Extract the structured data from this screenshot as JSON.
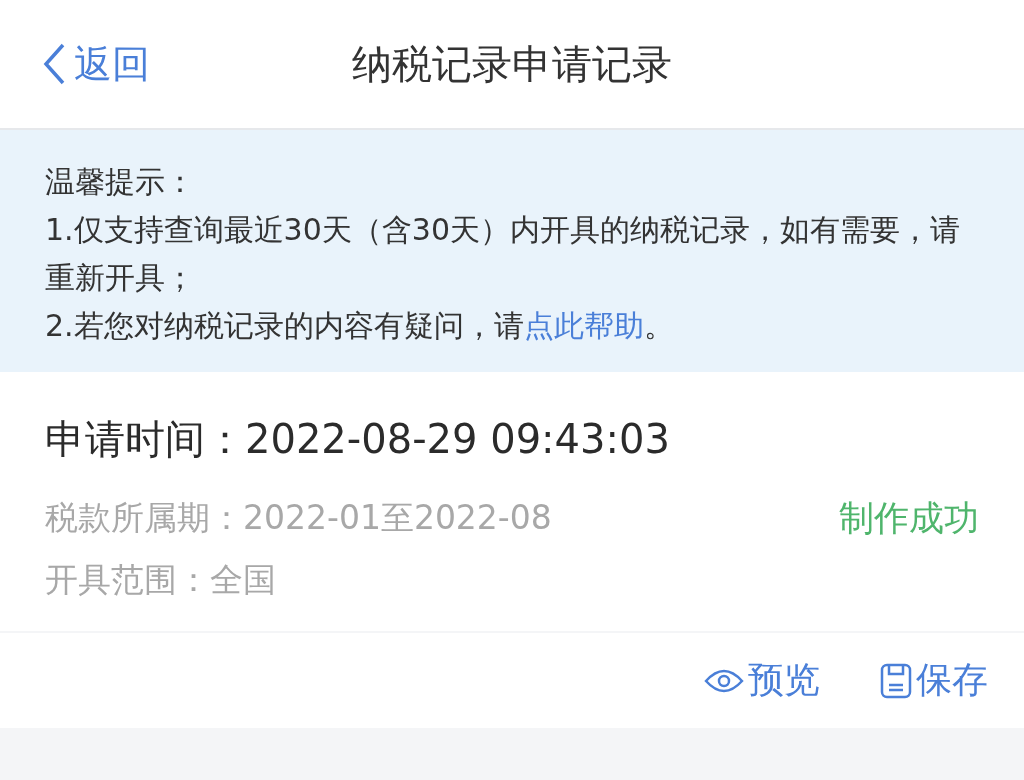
{
  "nav": {
    "back": "返回",
    "title": "纳税记录申请记录"
  },
  "notice": {
    "title": "温馨提示：",
    "items": [
      {
        "text": "1.仅支持查询最近30天（含30天）内开具的纳税记录，如有需要，请重新开具；"
      },
      {
        "text": "2.若您对纳税记录的内容有疑问，请",
        "link": "点此帮助",
        "suffix": "。"
      }
    ]
  },
  "record": {
    "time_label": "申请时间：",
    "time": "2022-08-29 09:43:03",
    "period_label": "税款所属期：",
    "period": "2022-01至2022-08",
    "scope_label": "开具范围：",
    "scope": "全国",
    "status": {
      "text": "制作成功",
      "kind": "success"
    }
  },
  "actions": [
    {
      "kind": "preview",
      "label": "预览"
    },
    {
      "kind": "save",
      "label": "保存"
    }
  ]
}
